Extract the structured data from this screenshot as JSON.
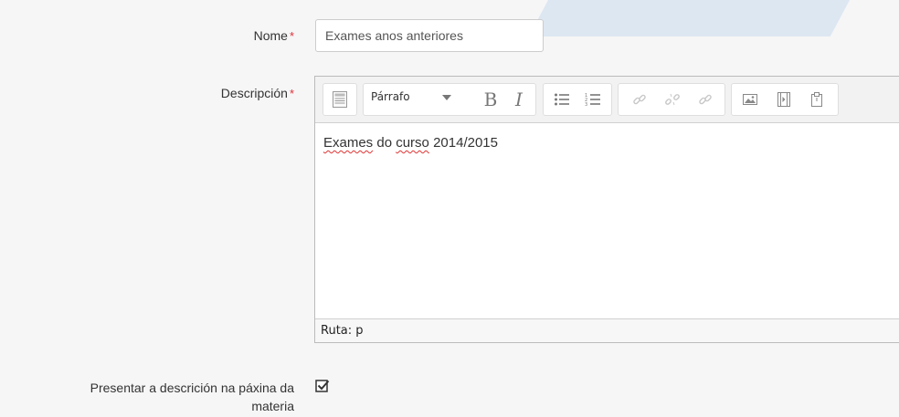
{
  "form": {
    "name": {
      "label": "Nome",
      "required_mark": "*",
      "value": "Exames anos anteriores"
    },
    "description": {
      "label": "Descripción",
      "required_mark": "*",
      "toolbar": {
        "format_select": "Párrafo",
        "bold_label": "B",
        "italic_label": "I"
      },
      "content": {
        "word1": "Exames",
        "word2": "do",
        "word3": "curso",
        "word4": "2014/2015"
      },
      "status_path": "Ruta: p"
    },
    "show_description": {
      "label_line1": "Presentar a descrición na páxina da",
      "label_line2": "materia",
      "checked": true
    }
  },
  "colors": {
    "required": "#e0303a",
    "watermark": "#d8e4f1",
    "background": "#f6f6f6"
  }
}
